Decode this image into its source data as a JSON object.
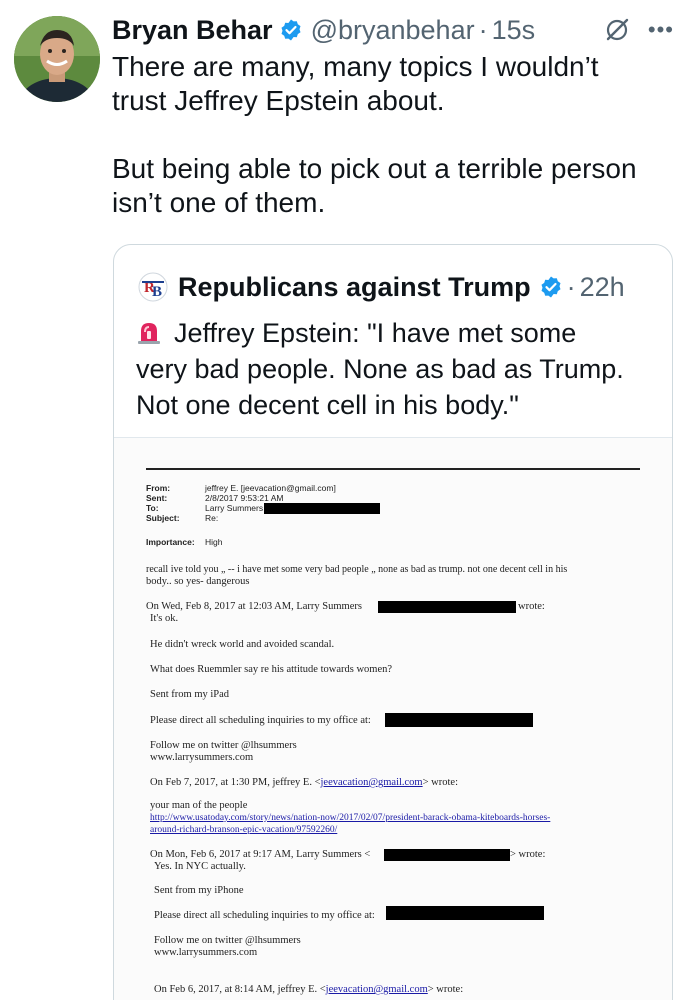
{
  "tweet": {
    "display_name": "Bryan Behar",
    "handle": "@bryanbehar",
    "separator": "·",
    "time": "15s",
    "lines": [
      "There are many, many topics I wouldn’t",
      "trust Jeffrey Epstein about.",
      "But being able to pick out a terrible person",
      "isn’t one of them."
    ],
    "icons": {
      "verified": "verified-badge-icon",
      "grok": "grok-icon",
      "more": "more-icon"
    }
  },
  "quote": {
    "display_name": "Republicans against Trump",
    "separator": "·",
    "time": "22h",
    "lines": [
      "Jeffrey Epstein: \"I have met some",
      "very bad people. None as bad as Trump.",
      "Not one decent cell in his body.\""
    ],
    "logo_text": "RB",
    "siren_icon": "police-siren-icon"
  },
  "email": {
    "headers": [
      {
        "label": "From:",
        "value": "jeffrey E. [jeevacation@gmail.com]"
      },
      {
        "label": "Sent:",
        "value": "2/8/2017 9:53:21 AM"
      },
      {
        "label": "To:",
        "value": "Larry Summers"
      },
      {
        "label": "Subject:",
        "value": "Re:"
      }
    ],
    "importance_label": "Importance:",
    "importance_value": "High",
    "body": [
      "recall ive told you  „  --  i have met some very  bad people  „  none as bad as trump.   not one decent cell in his",
      "body.. so yes- dangerous",
      "On Wed, Feb 8, 2017 at 12:03 AM, Larry Summers",
      "wrote:",
      "It's ok.",
      "He didn't wreck world and avoided scandal.",
      "What does Ruemmler say re his attitude towards women?",
      "Sent from my iPad",
      "Please direct all scheduling inquiries to my office at:",
      "Follow me on twitter @lhsummers",
      "www.larrysummers.com",
      "On Feb 7, 2017, at 1:30 PM, jeffrey E. <",
      "jeevacation@gmail.com",
      "> wrote:",
      "your man of the people",
      "http://www.usatoday.com/story/news/nation-now/2017/02/07/president-barack-obama-kiteboards-horses-",
      "around-richard-branson-epic-vacation/97592260/",
      "On Mon, Feb 6, 2017 at 9:17 AM, Larry Summers <",
      "> wrote:",
      "Yes. In NYC actually.",
      "Sent from my iPhone",
      "Please direct all scheduling inquiries to my office at:",
      "Follow me on twitter @lhsummers",
      "www.larrysummers.com",
      "On Feb 6, 2017, at 8:14 AM, jeffrey E. <",
      "jeevacation@gmail.com",
      "> wrote:"
    ]
  },
  "colors": {
    "text": "#0f1419",
    "secondary": "#536471",
    "verified": "#1d9bf0",
    "border": "#cfd9de",
    "link": "#1a1aa6"
  }
}
